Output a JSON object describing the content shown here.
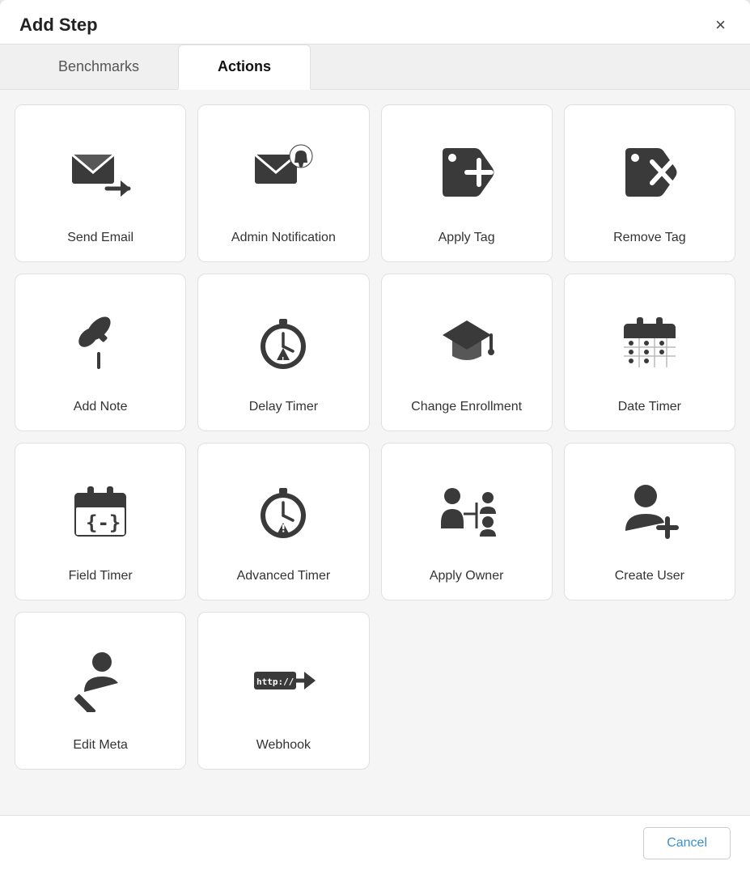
{
  "modal": {
    "title": "Add Step",
    "close_label": "×"
  },
  "tabs": [
    {
      "id": "benchmarks",
      "label": "Benchmarks",
      "active": false
    },
    {
      "id": "actions",
      "label": "Actions",
      "active": true
    }
  ],
  "actions": [
    {
      "id": "send-email",
      "label": "Send Email",
      "icon": "send-email"
    },
    {
      "id": "admin-notification",
      "label": "Admin Notification",
      "icon": "admin-notification"
    },
    {
      "id": "apply-tag",
      "label": "Apply Tag",
      "icon": "apply-tag"
    },
    {
      "id": "remove-tag",
      "label": "Remove Tag",
      "icon": "remove-tag"
    },
    {
      "id": "add-note",
      "label": "Add Note",
      "icon": "add-note"
    },
    {
      "id": "delay-timer",
      "label": "Delay Timer",
      "icon": "delay-timer"
    },
    {
      "id": "change-enrollment",
      "label": "Change Enrollment",
      "icon": "change-enrollment"
    },
    {
      "id": "date-timer",
      "label": "Date Timer",
      "icon": "date-timer"
    },
    {
      "id": "field-timer",
      "label": "Field Timer",
      "icon": "field-timer"
    },
    {
      "id": "advanced-timer",
      "label": "Advanced Timer",
      "icon": "advanced-timer"
    },
    {
      "id": "apply-owner",
      "label": "Apply Owner",
      "icon": "apply-owner"
    },
    {
      "id": "create-user",
      "label": "Create User",
      "icon": "create-user"
    },
    {
      "id": "edit-meta",
      "label": "Edit Meta",
      "icon": "edit-meta"
    },
    {
      "id": "webhook",
      "label": "Webhook",
      "icon": "webhook"
    }
  ],
  "footer": {
    "cancel_label": "Cancel"
  }
}
